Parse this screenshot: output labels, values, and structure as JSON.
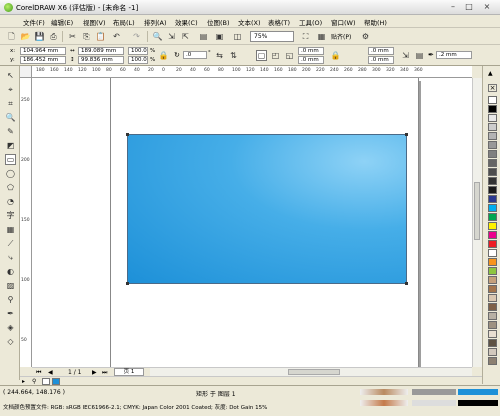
{
  "title": "CorelDRAW X6 (评估版) - [未命名 -1]",
  "window_controls": [
    "–",
    "□",
    "×"
  ],
  "menu": [
    "文件(F)",
    "编辑(E)",
    "视图(V)",
    "布局(L)",
    "排列(A)",
    "效果(C)",
    "位图(B)",
    "文本(X)",
    "表格(T)",
    "工具(O)",
    "窗口(W)",
    "帮助(H)"
  ],
  "zoom": "75%",
  "snap_label": "贴齐(P)",
  "props": {
    "x": "104.964 mm",
    "y": "186.452 mm",
    "w": "189.089 mm",
    "h": "99.836 mm",
    "sx": "100.0",
    "sy": "100.0",
    "pct": "%",
    "rotation": ".0",
    "corner_tl": ".0 mm",
    "corner_bl": ".0 mm",
    "corner_tr": ".0 mm",
    "corner_br": ".0 mm",
    "outline_width": ".2 mm"
  },
  "ruler_h_ticks": [
    "180",
    "160",
    "140",
    "120",
    "100",
    "80",
    "60",
    "40",
    "20",
    "0",
    "20",
    "40",
    "60",
    "80",
    "100",
    "120",
    "140",
    "160",
    "180",
    "200",
    "220",
    "240",
    "260",
    "280",
    "300",
    "320",
    "340",
    "360"
  ],
  "ruler_v_ticks": [
    "250",
    "200",
    "150",
    "100",
    "50"
  ],
  "page_nav": {
    "counter": "1 / 1",
    "tab": "页 1"
  },
  "status": {
    "coords": "( 244.664, 148.176 )",
    "object_info": "矩形 于 图层 1",
    "color_profile": "文档颜色预置文件: RGB: sRGB IEC61966-2.1; CMYK: Japan Color 2001 Coated; 灰度: Dot Gain 15%"
  },
  "palette_colors": [
    "#ffffff",
    "#000000",
    "#e6e6e6",
    "#cccccc",
    "#b3b3b3",
    "#999999",
    "#808080",
    "#666666",
    "#4d4d4d",
    "#333333",
    "#1a1a1a",
    "#2b3990",
    "#00aeef",
    "#00a651",
    "#fff200",
    "#ec008c",
    "#ed1c24",
    "#ffffff",
    "#f7941d",
    "#8dc63f",
    "#c4a07a",
    "#a3754b",
    "#d9c7b0",
    "#7f6148",
    "#b7b0a4",
    "#9e9281",
    "#e8dfd2",
    "#5e5344",
    "#d2c9bd",
    "#8c8072"
  ]
}
